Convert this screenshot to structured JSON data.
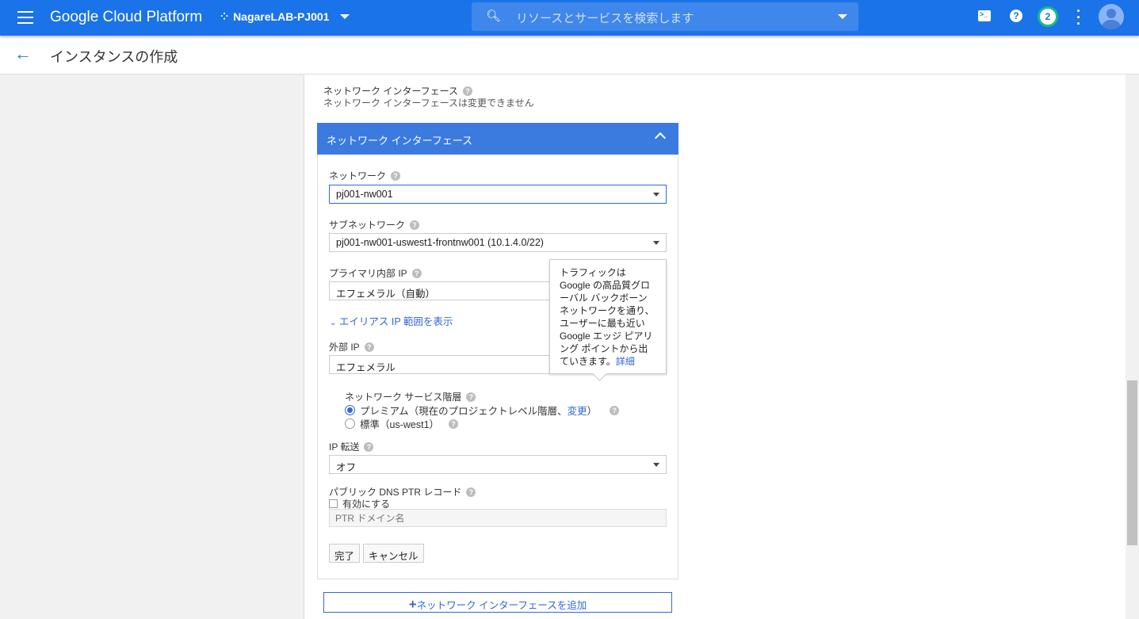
{
  "header": {
    "title": "Google Cloud Platform",
    "project": "NagareLAB-PJ001",
    "search_placeholder": "リソースとサービスを検索します",
    "notifications": "2"
  },
  "page": {
    "title": "インスタンスの作成"
  },
  "section": {
    "title": "ネットワーク インターフェース",
    "note": "ネットワーク インターフェースは変更できません"
  },
  "card": {
    "title": "ネットワーク インターフェース",
    "network": {
      "label": "ネットワーク",
      "value": "pj001-nw001"
    },
    "subnet": {
      "label": "サブネットワーク",
      "value": "pj001-nw001-uswest1-frontnw001 (10.1.4.0/22)"
    },
    "primary_ip": {
      "label": "プライマリ内部 IP",
      "value": "エフェメラル（自動）"
    },
    "alias_link": "エイリアス IP 範囲を表示",
    "external_ip": {
      "label": "外部 IP",
      "value": "エフェメラル"
    },
    "tier": {
      "label": "ネットワーク サービス階層",
      "premium": "プレミアム（現在のプロジェクトレベル階層、",
      "change": "変更",
      "premium_end": "）",
      "standard": "標準（us-west1）",
      "selected": "premium"
    },
    "ip_forward": {
      "label": "IP 転送",
      "value": "オフ"
    },
    "dns": {
      "label": "パブリック DNS PTR レコード",
      "checkbox": "有効にする",
      "checked": false,
      "placeholder": "PTR ドメイン名"
    },
    "done": "完了",
    "cancel": "キャンセル"
  },
  "tooltip": {
    "text": "トラフィックは Google の高品質グローバル バックボーン ネットワークを通り、ユーザーに最も近い Google エッジ ピアリング ポイントから出ていきます。",
    "link": "詳細"
  },
  "add_interface": "ネットワーク インターフェースを追加",
  "colors": {
    "header": "#1a73e8",
    "card_header": "#3b7be0",
    "link": "#3367d6"
  }
}
